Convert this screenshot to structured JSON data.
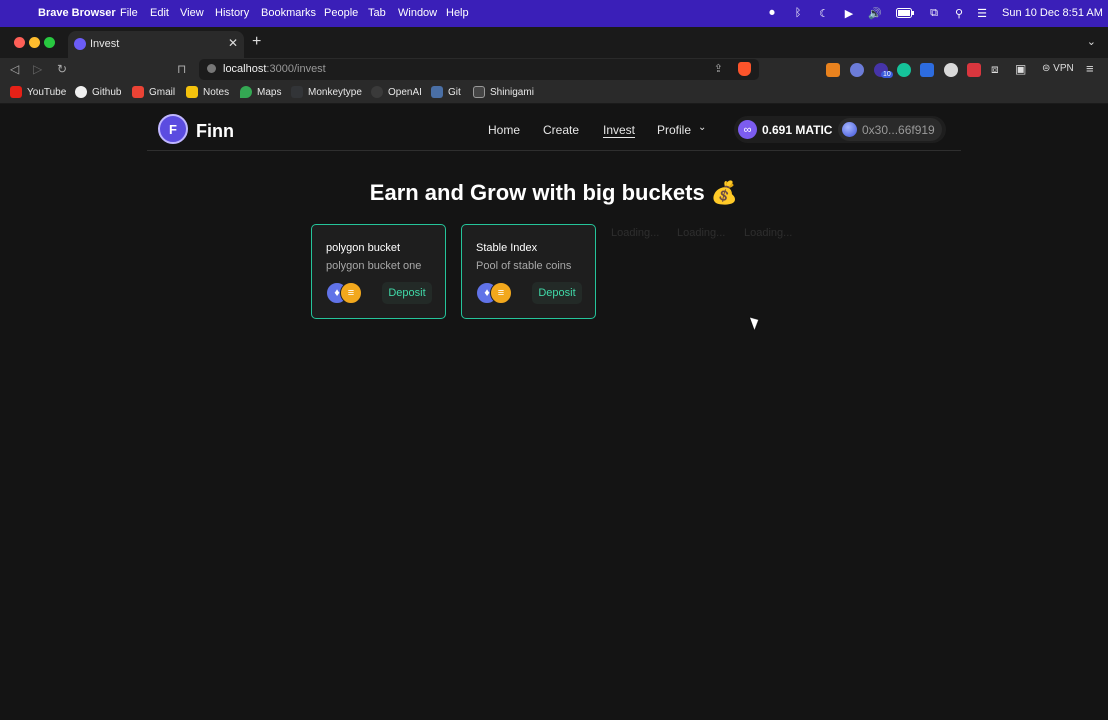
{
  "menubar": {
    "app": "Brave Browser",
    "items": [
      "File",
      "Edit",
      "View",
      "History",
      "Bookmarks",
      "People",
      "Tab",
      "Window",
      "Help"
    ],
    "clock": "Sun 10 Dec  8:51 AM"
  },
  "tab": {
    "title": "Invest"
  },
  "toolbar": {
    "url_host": "localhost",
    "url_rest": ":3000/invest",
    "vpn": "VPN",
    "extension_badge": "10"
  },
  "bookmarks": [
    "YouTube",
    "Github",
    "Gmail",
    "Notes",
    "Maps",
    "Monkeytype",
    "OpenAI",
    "Git",
    "Shinigami"
  ],
  "site": {
    "brand": "Finn",
    "nav": [
      "Home",
      "Create",
      "Invest",
      "Profile"
    ],
    "balance": "0.691 MATIC",
    "address": "0x30...66f919",
    "hero": "Earn and Grow with big buckets 💰",
    "buckets": [
      {
        "name": "polygon bucket",
        "description": "polygon bucket one",
        "action": "Deposit"
      },
      {
        "name": "Stable Index",
        "description": "Pool of stable coins",
        "action": "Deposit"
      }
    ],
    "loading": [
      "Loading...",
      "Loading...",
      "Loading..."
    ]
  },
  "colors": {
    "menubar": "#3a1fb8",
    "accent_green": "#25c49a",
    "deposit_text": "#40d9a8",
    "page_bg": "#141414"
  }
}
